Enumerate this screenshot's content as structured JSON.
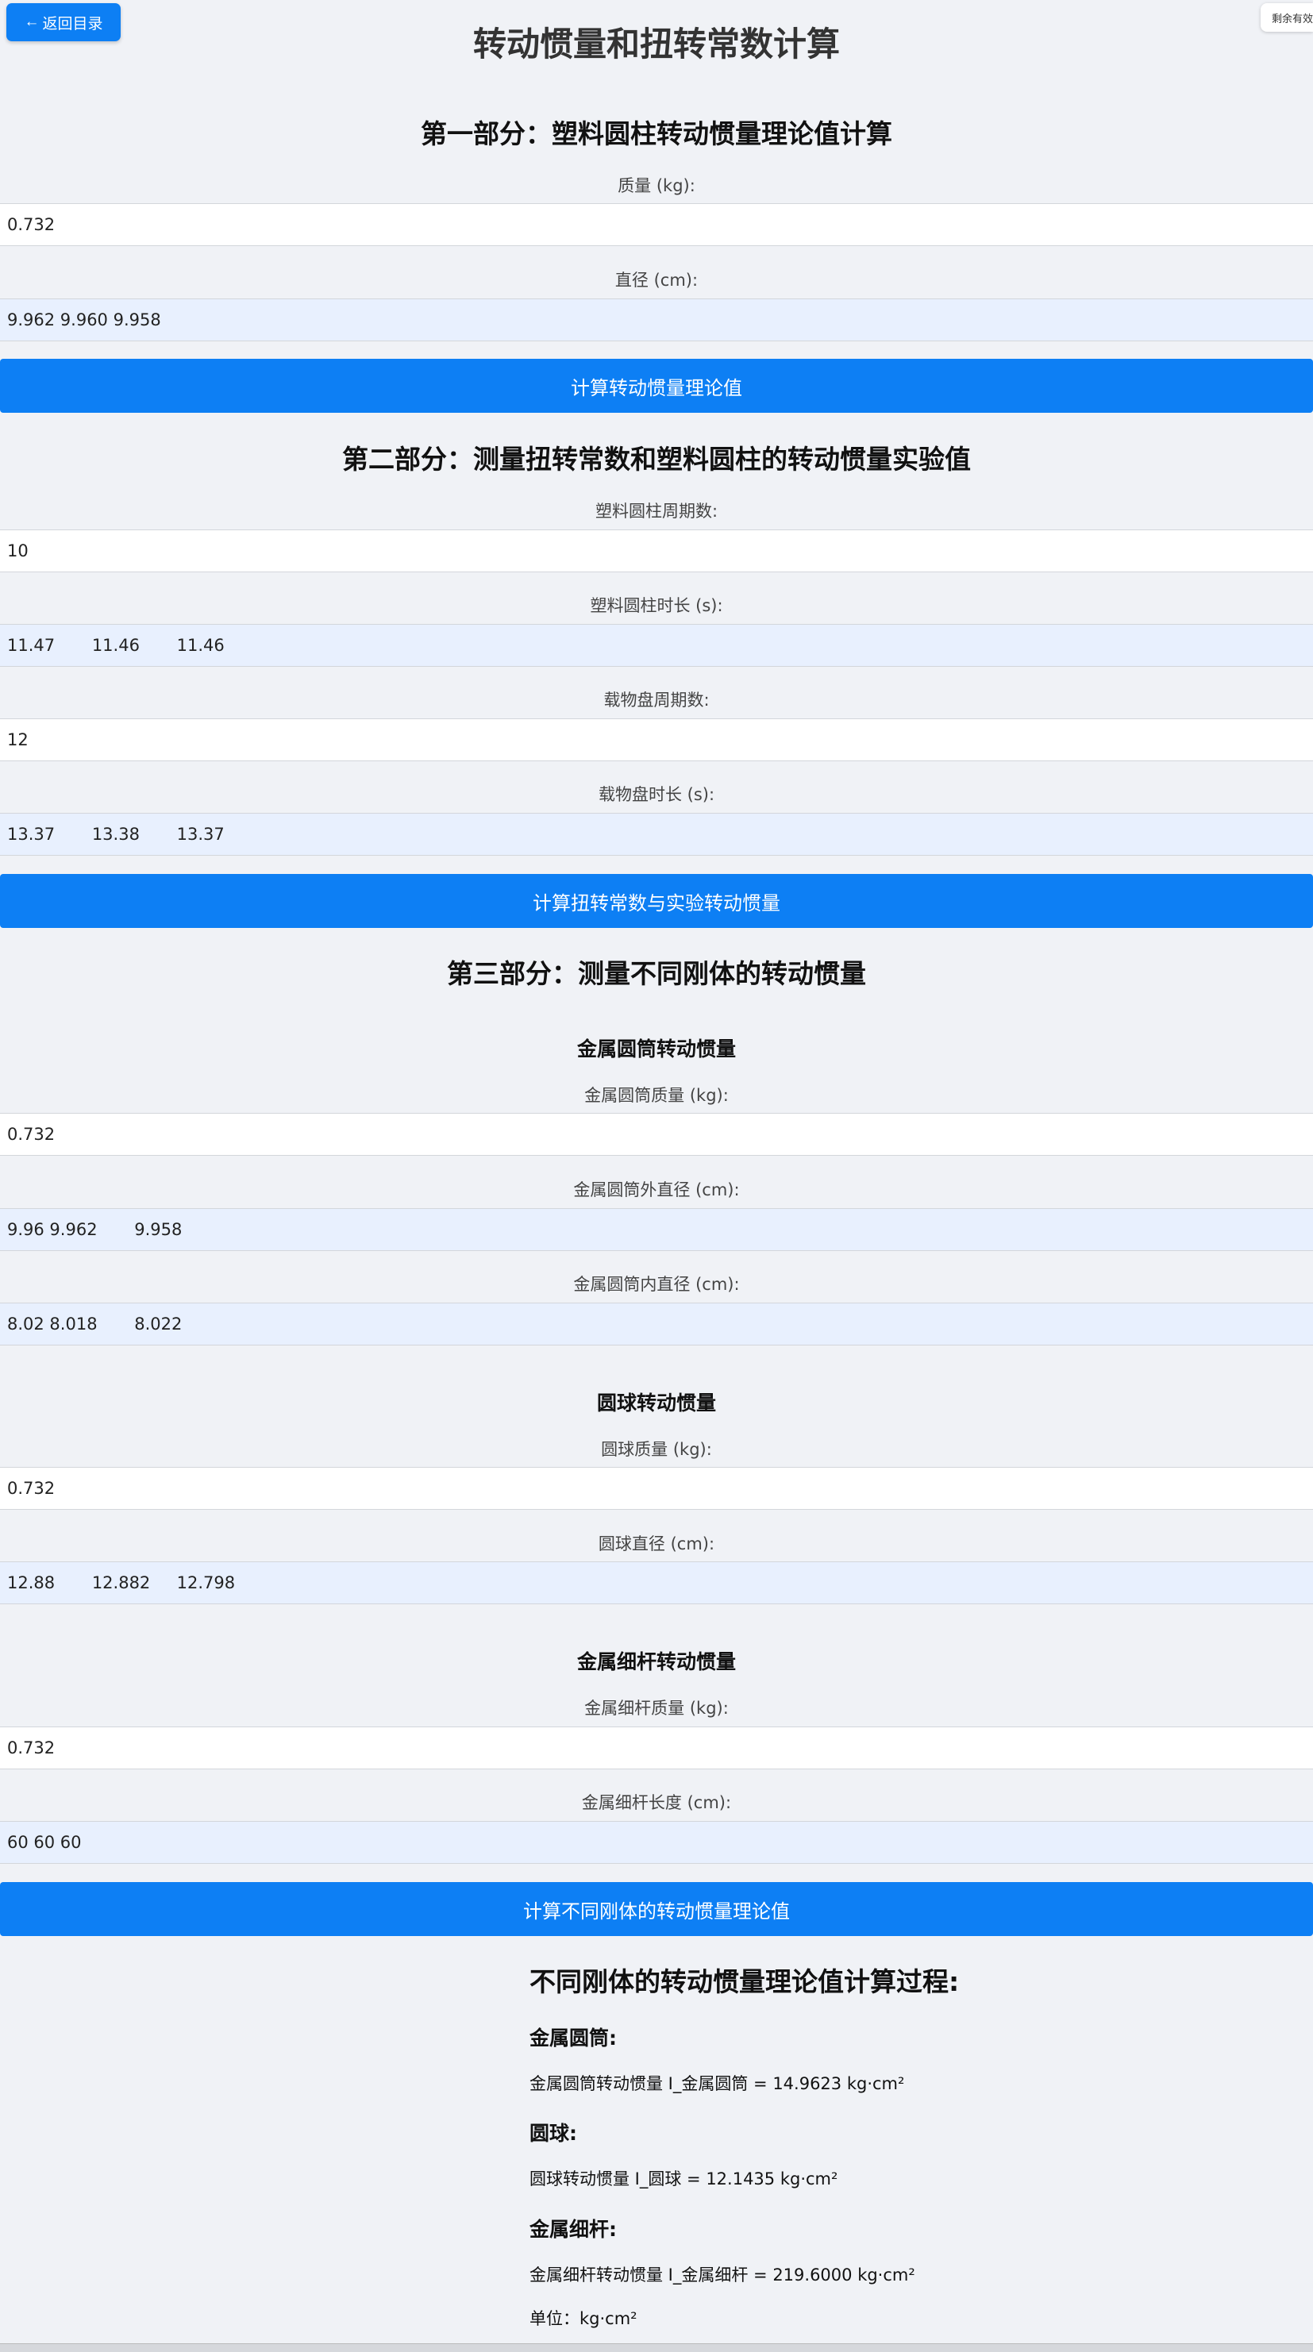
{
  "back_button": {
    "arrow": "←",
    "label": "返回目录"
  },
  "timer_text": "剩余有效",
  "page_title": "转动惯量和扭转常数计算",
  "part1": {
    "title": "第一部分：塑料圆柱转动惯量理论值计算",
    "mass_label": "质量 (kg):",
    "mass_value": "0.732",
    "diameter_label": "直径 (cm):",
    "diameter_value": "9.962 9.960 9.958",
    "button": "计算转动惯量理论值"
  },
  "part2": {
    "title": "第二部分：测量扭转常数和塑料圆柱的转动惯量实验值",
    "cyl_periods_label": "塑料圆柱周期数:",
    "cyl_periods_value": "10",
    "cyl_time_label": "塑料圆柱时长 (s):",
    "cyl_time_value": "11.47\t11.46\t11.46",
    "disk_periods_label": "载物盘周期数:",
    "disk_periods_value": "12",
    "disk_time_label": "载物盘时长 (s):",
    "disk_time_value": "13.37\t13.38\t13.37",
    "button": "计算扭转常数与实验转动惯量"
  },
  "part3": {
    "title": "第三部分：测量不同刚体的转动惯量",
    "tube": {
      "heading": "金属圆筒转动惯量",
      "mass_label": "金属圆筒质量 (kg):",
      "mass_value": "0.732",
      "outer_label": "金属圆筒外直径 (cm):",
      "outer_value": "9.96 9.962\t9.958",
      "inner_label": "金属圆筒内直径 (cm):",
      "inner_value": "8.02 8.018\t8.022"
    },
    "sphere": {
      "heading": "圆球转动惯量",
      "mass_label": "圆球质量 (kg):",
      "mass_value": "0.732",
      "diameter_label": "圆球直径 (cm):",
      "diameter_value": "12.88\t12.882\t12.798"
    },
    "rod": {
      "heading": "金属细杆转动惯量",
      "mass_label": "金属细杆质量 (kg):",
      "mass_value": "0.732",
      "length_label": "金属细杆长度 (cm):",
      "length_value": "60 60 60"
    },
    "button": "计算不同刚体的转动惯量理论值"
  },
  "results": {
    "title": "不同刚体的转动惯量理论值计算过程:",
    "tube_heading": "金属圆筒:",
    "tube_line": "金属圆筒转动惯量 I_金属圆筒 = 14.9623 kg·cm²",
    "sphere_heading": "圆球:",
    "sphere_line": "圆球转动惯量 I_圆球 = 12.1435 kg·cm²",
    "rod_heading": "金属细杆:",
    "rod_line": "金属细杆转动惯量 I_金属细杆 = 219.6000 kg·cm²",
    "unit_line": "单位：kg·cm²"
  },
  "colors": {
    "accent": "#0d7ff4",
    "background": "#f0f2f6",
    "input_autofill": "#e8f0fe"
  }
}
